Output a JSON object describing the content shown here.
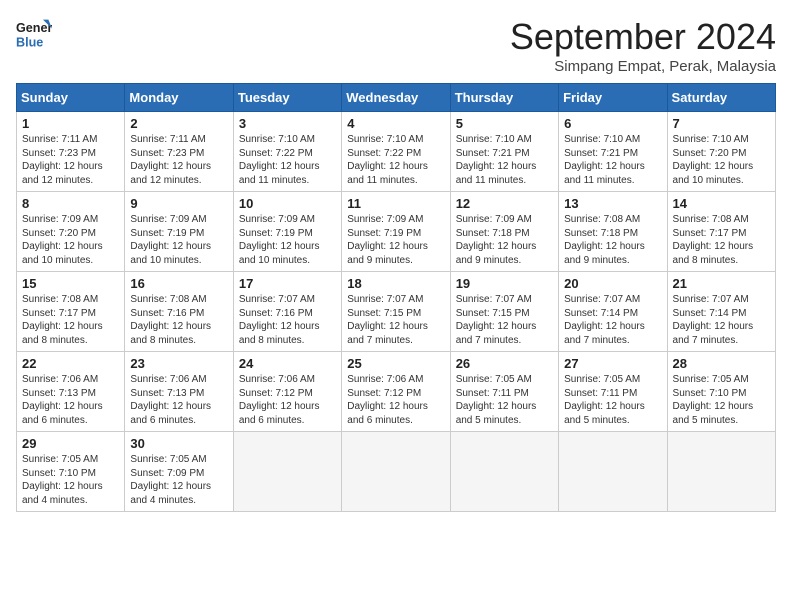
{
  "logo": {
    "line1": "General",
    "line2": "Blue"
  },
  "title": "September 2024",
  "subtitle": "Simpang Empat, Perak, Malaysia",
  "weekdays": [
    "Sunday",
    "Monday",
    "Tuesday",
    "Wednesday",
    "Thursday",
    "Friday",
    "Saturday"
  ],
  "weeks": [
    [
      {
        "day": 1,
        "sunrise": "7:11 AM",
        "sunset": "7:23 PM",
        "daylight": "12 hours and 12 minutes."
      },
      {
        "day": 2,
        "sunrise": "7:11 AM",
        "sunset": "7:23 PM",
        "daylight": "12 hours and 12 minutes."
      },
      {
        "day": 3,
        "sunrise": "7:10 AM",
        "sunset": "7:22 PM",
        "daylight": "12 hours and 11 minutes."
      },
      {
        "day": 4,
        "sunrise": "7:10 AM",
        "sunset": "7:22 PM",
        "daylight": "12 hours and 11 minutes."
      },
      {
        "day": 5,
        "sunrise": "7:10 AM",
        "sunset": "7:21 PM",
        "daylight": "12 hours and 11 minutes."
      },
      {
        "day": 6,
        "sunrise": "7:10 AM",
        "sunset": "7:21 PM",
        "daylight": "12 hours and 11 minutes."
      },
      {
        "day": 7,
        "sunrise": "7:10 AM",
        "sunset": "7:20 PM",
        "daylight": "12 hours and 10 minutes."
      }
    ],
    [
      {
        "day": 8,
        "sunrise": "7:09 AM",
        "sunset": "7:20 PM",
        "daylight": "12 hours and 10 minutes."
      },
      {
        "day": 9,
        "sunrise": "7:09 AM",
        "sunset": "7:19 PM",
        "daylight": "12 hours and 10 minutes."
      },
      {
        "day": 10,
        "sunrise": "7:09 AM",
        "sunset": "7:19 PM",
        "daylight": "12 hours and 10 minutes."
      },
      {
        "day": 11,
        "sunrise": "7:09 AM",
        "sunset": "7:19 PM",
        "daylight": "12 hours and 9 minutes."
      },
      {
        "day": 12,
        "sunrise": "7:09 AM",
        "sunset": "7:18 PM",
        "daylight": "12 hours and 9 minutes."
      },
      {
        "day": 13,
        "sunrise": "7:08 AM",
        "sunset": "7:18 PM",
        "daylight": "12 hours and 9 minutes."
      },
      {
        "day": 14,
        "sunrise": "7:08 AM",
        "sunset": "7:17 PM",
        "daylight": "12 hours and 8 minutes."
      }
    ],
    [
      {
        "day": 15,
        "sunrise": "7:08 AM",
        "sunset": "7:17 PM",
        "daylight": "12 hours and 8 minutes."
      },
      {
        "day": 16,
        "sunrise": "7:08 AM",
        "sunset": "7:16 PM",
        "daylight": "12 hours and 8 minutes."
      },
      {
        "day": 17,
        "sunrise": "7:07 AM",
        "sunset": "7:16 PM",
        "daylight": "12 hours and 8 minutes."
      },
      {
        "day": 18,
        "sunrise": "7:07 AM",
        "sunset": "7:15 PM",
        "daylight": "12 hours and 7 minutes."
      },
      {
        "day": 19,
        "sunrise": "7:07 AM",
        "sunset": "7:15 PM",
        "daylight": "12 hours and 7 minutes."
      },
      {
        "day": 20,
        "sunrise": "7:07 AM",
        "sunset": "7:14 PM",
        "daylight": "12 hours and 7 minutes."
      },
      {
        "day": 21,
        "sunrise": "7:07 AM",
        "sunset": "7:14 PM",
        "daylight": "12 hours and 7 minutes."
      }
    ],
    [
      {
        "day": 22,
        "sunrise": "7:06 AM",
        "sunset": "7:13 PM",
        "daylight": "12 hours and 6 minutes."
      },
      {
        "day": 23,
        "sunrise": "7:06 AM",
        "sunset": "7:13 PM",
        "daylight": "12 hours and 6 minutes."
      },
      {
        "day": 24,
        "sunrise": "7:06 AM",
        "sunset": "7:12 PM",
        "daylight": "12 hours and 6 minutes."
      },
      {
        "day": 25,
        "sunrise": "7:06 AM",
        "sunset": "7:12 PM",
        "daylight": "12 hours and 6 minutes."
      },
      {
        "day": 26,
        "sunrise": "7:05 AM",
        "sunset": "7:11 PM",
        "daylight": "12 hours and 5 minutes."
      },
      {
        "day": 27,
        "sunrise": "7:05 AM",
        "sunset": "7:11 PM",
        "daylight": "12 hours and 5 minutes."
      },
      {
        "day": 28,
        "sunrise": "7:05 AM",
        "sunset": "7:10 PM",
        "daylight": "12 hours and 5 minutes."
      }
    ],
    [
      {
        "day": 29,
        "sunrise": "7:05 AM",
        "sunset": "7:10 PM",
        "daylight": "12 hours and 4 minutes."
      },
      {
        "day": 30,
        "sunrise": "7:05 AM",
        "sunset": "7:09 PM",
        "daylight": "12 hours and 4 minutes."
      },
      null,
      null,
      null,
      null,
      null
    ]
  ]
}
